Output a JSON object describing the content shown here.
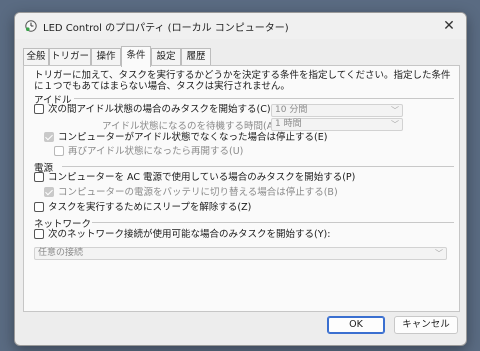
{
  "window": {
    "title": "LED Control のプロパティ (ローカル コンピューター)"
  },
  "tabs": [
    "全般",
    "トリガー",
    "操作",
    "条件",
    "設定",
    "履歴"
  ],
  "intro": "トリガーに加えて、タスクを実行するかどうかを決定する条件を指定してください。指定した条件に１つでもあてはまらない場合、タスクは実行されません。",
  "idle": {
    "group": "アイドル",
    "start_label": "次の間アイドル状態の場合のみタスクを開始する(C):",
    "start_value": "10 分間",
    "wait_label": "アイドル状態になるのを待機する時間(A):",
    "wait_value": "1 時間",
    "stop_label": "コンピューターがアイドル状態でなくなった場合は停止する(E)",
    "restart_label": "再びアイドル状態になったら再開する(U)"
  },
  "power": {
    "group": "電源",
    "ac_label": "コンピューターを AC 電源で使用している場合のみタスクを開始する(P)",
    "battery_label": "コンピューターの電源をバッテリに切り替える場合は停止する(B)",
    "wake_label": "タスクを実行するためにスリープを解除する(Z)"
  },
  "network": {
    "group": "ネットワーク",
    "start_label": "次のネットワーク接続が使用可能な場合のみタスクを開始する(Y):",
    "connection_value": "任意の接続"
  },
  "buttons": {
    "ok": "OK",
    "cancel": "キャンセル"
  }
}
